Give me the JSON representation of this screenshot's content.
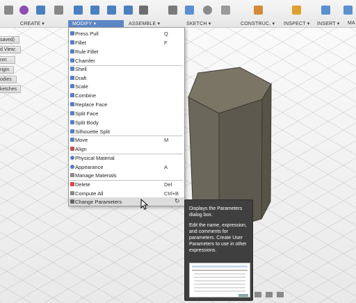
{
  "toolbar": {
    "workspaces": [
      {
        "label": "CREATE ▾",
        "active": false
      },
      {
        "label": "MODIFY ▾",
        "active": true
      },
      {
        "label": "ASSEMBLE ▾",
        "active": false
      },
      {
        "label": "SKETCH ▾",
        "active": false
      },
      {
        "label": "CONSTRUC. ▾",
        "active": false
      },
      {
        "label": "INSPECT ▾",
        "active": false
      },
      {
        "label": "INSERT ▾",
        "active": false
      },
      {
        "label": "MA",
        "active": false
      }
    ]
  },
  "browser": {
    "items": [
      {
        "label": "saved)"
      },
      {
        "label": "d View:"
      },
      {
        "label": "nm"
      },
      {
        "label": "rigin"
      },
      {
        "label": "odies"
      },
      {
        "label": "ketches"
      }
    ]
  },
  "modify_menu": {
    "items": [
      {
        "label": "Press Pull",
        "shortcut": "Q",
        "icon": "press-pull-icon"
      },
      {
        "label": "Fillet",
        "shortcut": "F",
        "icon": "fillet-icon"
      },
      {
        "label": "Rule Fillet",
        "shortcut": "",
        "icon": "rule-fillet-icon"
      },
      {
        "label": "Chamfer",
        "shortcut": "",
        "icon": "chamfer-icon"
      },
      {
        "label": "Shell",
        "shortcut": "",
        "icon": "shell-icon"
      },
      {
        "label": "Draft",
        "shortcut": "",
        "icon": "draft-icon"
      },
      {
        "label": "Scale",
        "shortcut": "",
        "icon": "scale-icon"
      },
      {
        "label": "Combine",
        "shortcut": "",
        "icon": "combine-icon"
      },
      {
        "label": "Replace Face",
        "shortcut": "",
        "icon": "replace-face-icon"
      },
      {
        "label": "Split Face",
        "shortcut": "",
        "icon": "split-face-icon"
      },
      {
        "label": "Split Body",
        "shortcut": "",
        "icon": "split-body-icon"
      },
      {
        "label": "Silhouette Split",
        "shortcut": "",
        "icon": "silhouette-split-icon"
      },
      {
        "label": "Move",
        "shortcut": "M",
        "icon": "move-icon"
      },
      {
        "label": "Align",
        "shortcut": "",
        "icon": "align-icon"
      },
      {
        "label": "Physical Material",
        "shortcut": "",
        "icon": "physical-material-icon"
      },
      {
        "label": "Appearance",
        "shortcut": "A",
        "icon": "appearance-icon"
      },
      {
        "label": "Manage Materials",
        "shortcut": "",
        "icon": "manage-materials-icon"
      },
      {
        "label": "Delete",
        "shortcut": "Del",
        "icon": "delete-icon"
      },
      {
        "label": "Compute All",
        "shortcut": "Ctrl+B",
        "icon": "compute-all-icon"
      },
      {
        "label": "Change Parameters",
        "shortcut": "",
        "icon": "change-parameters-icon"
      }
    ]
  },
  "tooltip": {
    "title": "Displays the Parameters dialog box.",
    "body": "Edit the name, expression, and comments for parameters. Create User Parameters to use in other expressions."
  },
  "colors": {
    "accent": "#5d86c4",
    "menu_highlight": "#dcdcdc",
    "tooltip_bg": "#3f3f3f",
    "prism_side": "#6b675b",
    "prism_front": "#5d594e",
    "prism_top": "#7a7565"
  }
}
